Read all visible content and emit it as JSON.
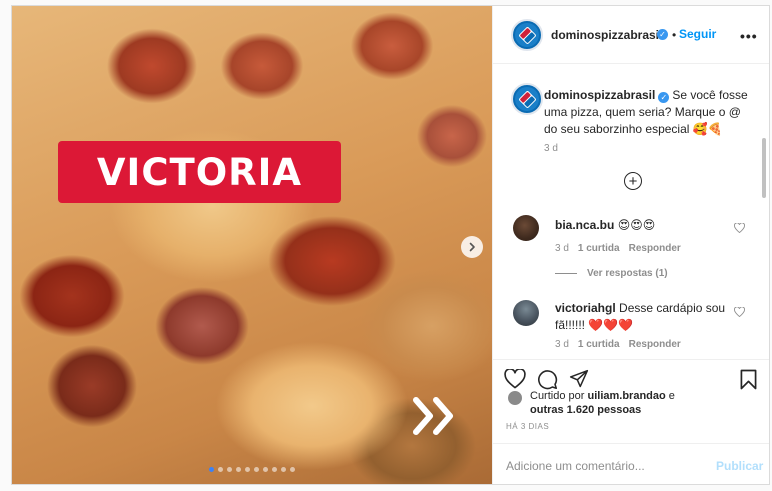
{
  "post": {
    "account": "dominospizzabrasil",
    "follow_label": "Seguir",
    "follow_sep": "•",
    "more_label": "•••"
  },
  "media": {
    "overlay_text": "VICTORIA",
    "carousel_slides": 10,
    "carousel_active": 1
  },
  "caption": {
    "username": "dominospizzabrasil",
    "text": "Se você fosse uma pizza, quem seria? Marque o @ do seu saborzinho especial 🥰🍕",
    "time": "3 d"
  },
  "comments": [
    {
      "username": "bia.nca.bu",
      "text": "😍😍😍",
      "time": "3 d",
      "likes": "1 curtida",
      "reply": "Responder",
      "view_replies": "Ver respostas (1)"
    },
    {
      "username": "victoriahgl",
      "text": "Desse cardápio sou fã!!!!!! ❤️❤️❤️",
      "time": "3 d",
      "likes": "1 curtida",
      "reply": "Responder"
    }
  ],
  "likes": {
    "prefix": "Curtido por",
    "user": "uiliam.brandao",
    "conj": "e",
    "others": "outras 1.620 pessoas"
  },
  "time_ago": "HÁ 3 DIAS",
  "add_comment": {
    "placeholder": "Adicione um comentário...",
    "publish_label": "Publicar"
  },
  "colors": {
    "brand_red": "#dc1836",
    "brand_blue": "#0a6bb3",
    "link_blue": "#0095f6",
    "verified_blue": "#3897f0",
    "publish_disabled": "#b2dffc"
  }
}
